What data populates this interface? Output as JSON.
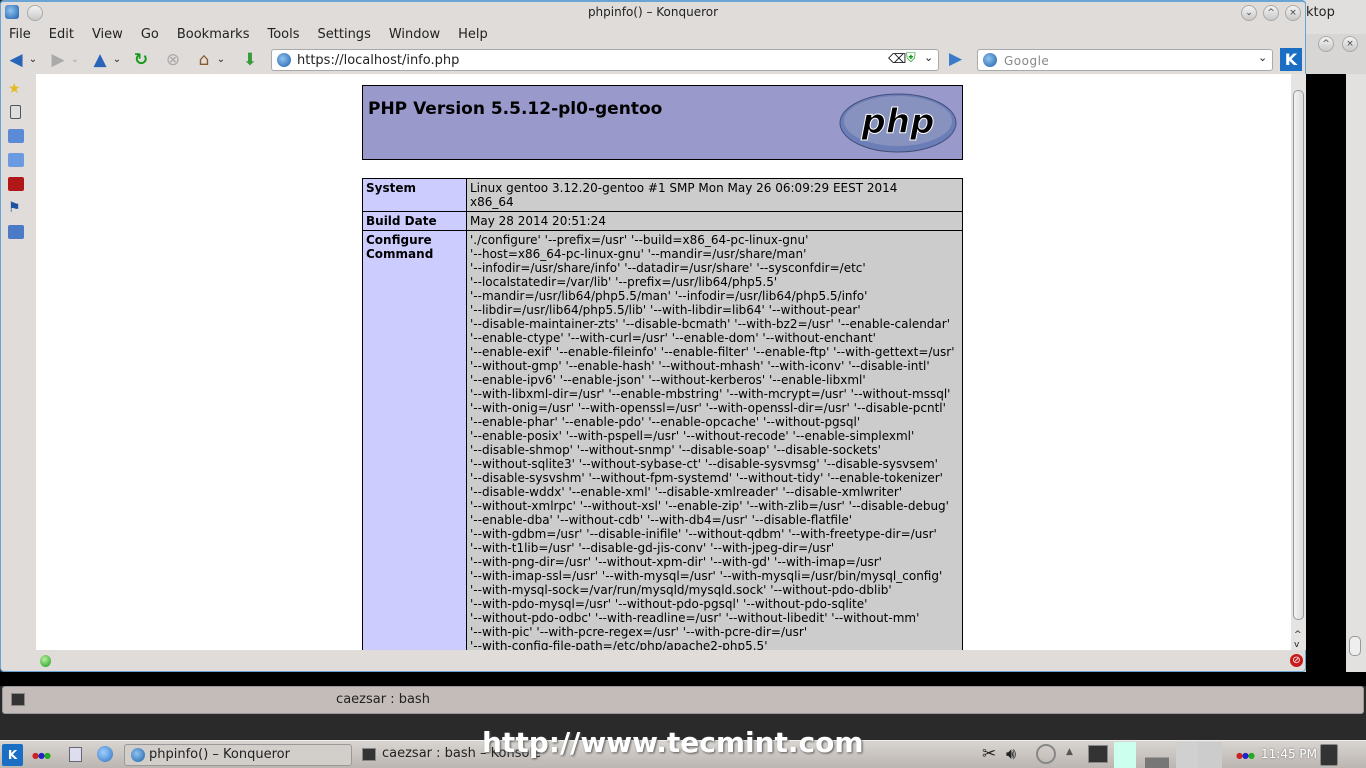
{
  "window": {
    "title": "phpinfo() – Konqueror",
    "bg_title_fragment": "ktop"
  },
  "menu": [
    "File",
    "Edit",
    "View",
    "Go",
    "Bookmarks",
    "Tools",
    "Settings",
    "Window",
    "Help"
  ],
  "toolbar": {
    "url": "https://localhost/info.php",
    "search_placeholder": "Google"
  },
  "page": {
    "php_version": "PHP Version 5.5.12-pl0-gentoo",
    "logo_text": "php",
    "rows": [
      {
        "label": "System",
        "lines": [
          "Linux gentoo 3.12.20-gentoo #1 SMP Mon May 26 06:09:29 EEST 2014",
          "x86_64"
        ]
      },
      {
        "label": "Build Date",
        "lines": [
          "May 28 2014 20:51:24"
        ]
      },
      {
        "label": "Configure Command",
        "lines": [
          "'./configure' '--prefix=/usr' '--build=x86_64-pc-linux-gnu'",
          "'--host=x86_64-pc-linux-gnu' '--mandir=/usr/share/man'",
          "'--infodir=/usr/share/info' '--datadir=/usr/share' '--sysconfdir=/etc'",
          "'--localstatedir=/var/lib' '--prefix=/usr/lib64/php5.5'",
          "'--mandir=/usr/lib64/php5.5/man' '--infodir=/usr/lib64/php5.5/info'",
          "'--libdir=/usr/lib64/php5.5/lib' '--with-libdir=lib64' '--without-pear'",
          "'--disable-maintainer-zts' '--disable-bcmath' '--with-bz2=/usr' '--enable-calendar'",
          "'--enable-ctype' '--with-curl=/usr' '--enable-dom' '--without-enchant'",
          "'--enable-exif' '--enable-fileinfo' '--enable-filter' '--enable-ftp' '--with-gettext=/usr'",
          "'--without-gmp' '--enable-hash' '--without-mhash' '--with-iconv' '--disable-intl'",
          "'--enable-ipv6' '--enable-json' '--without-kerberos' '--enable-libxml'",
          "'--with-libxml-dir=/usr' '--enable-mbstring' '--with-mcrypt=/usr' '--without-mssql'",
          "'--with-onig=/usr' '--with-openssl=/usr' '--with-openssl-dir=/usr' '--disable-pcntl'",
          "'--enable-phar' '--enable-pdo' '--enable-opcache' '--without-pgsql'",
          "'--enable-posix' '--with-pspell=/usr' '--without-recode' '--enable-simplexml'",
          "'--disable-shmop' '--without-snmp' '--disable-soap' '--disable-sockets'",
          "'--without-sqlite3' '--without-sybase-ct' '--disable-sysvmsg' '--disable-sysvsem'",
          "'--disable-sysvshm' '--without-fpm-systemd' '--without-tidy' '--enable-tokenizer'",
          "'--disable-wddx' '--enable-xml' '--disable-xmlreader' '--disable-xmlwriter'",
          "'--without-xmlrpc' '--without-xsl' '--enable-zip' '--with-zlib=/usr' '--disable-debug'",
          "'--enable-dba' '--without-cdb' '--with-db4=/usr' '--disable-flatfile'",
          "'--with-gdbm=/usr' '--disable-inifile' '--without-qdbm' '--with-freetype-dir=/usr'",
          "'--with-t1lib=/usr' '--disable-gd-jis-conv' '--with-jpeg-dir=/usr'",
          "'--with-png-dir=/usr' '--without-xpm-dir' '--with-gd' '--with-imap=/usr'",
          "'--with-imap-ssl=/usr' '--with-mysql=/usr' '--with-mysqli=/usr/bin/mysql_config'",
          "'--with-mysql-sock=/var/run/mysqld/mysqld.sock' '--without-pdo-dblib'",
          "'--with-pdo-mysql=/usr' '--without-pdo-pgsql' '--without-pdo-sqlite'",
          "'--without-pdo-odbc' '--with-readline=/usr' '--without-libedit' '--without-mm'",
          "'--with-pic' '--with-pcre-regex=/usr' '--with-pcre-dir=/usr'",
          "'--with-config-file-path=/etc/php/apache2-php5.5'"
        ]
      }
    ]
  },
  "konsole": {
    "tab": "caezsar : bash"
  },
  "taskbar": {
    "tasks": [
      "phpinfo() – Konqueror",
      "caezsar : bash – Konsole"
    ],
    "clock": "11:45 PM"
  },
  "watermark": "http://www.tecmint.com",
  "colors": {
    "php_header": "#9999cc",
    "label_cell": "#ccccff",
    "value_cell": "#cccccc",
    "window_border": "#6aa4d4"
  }
}
